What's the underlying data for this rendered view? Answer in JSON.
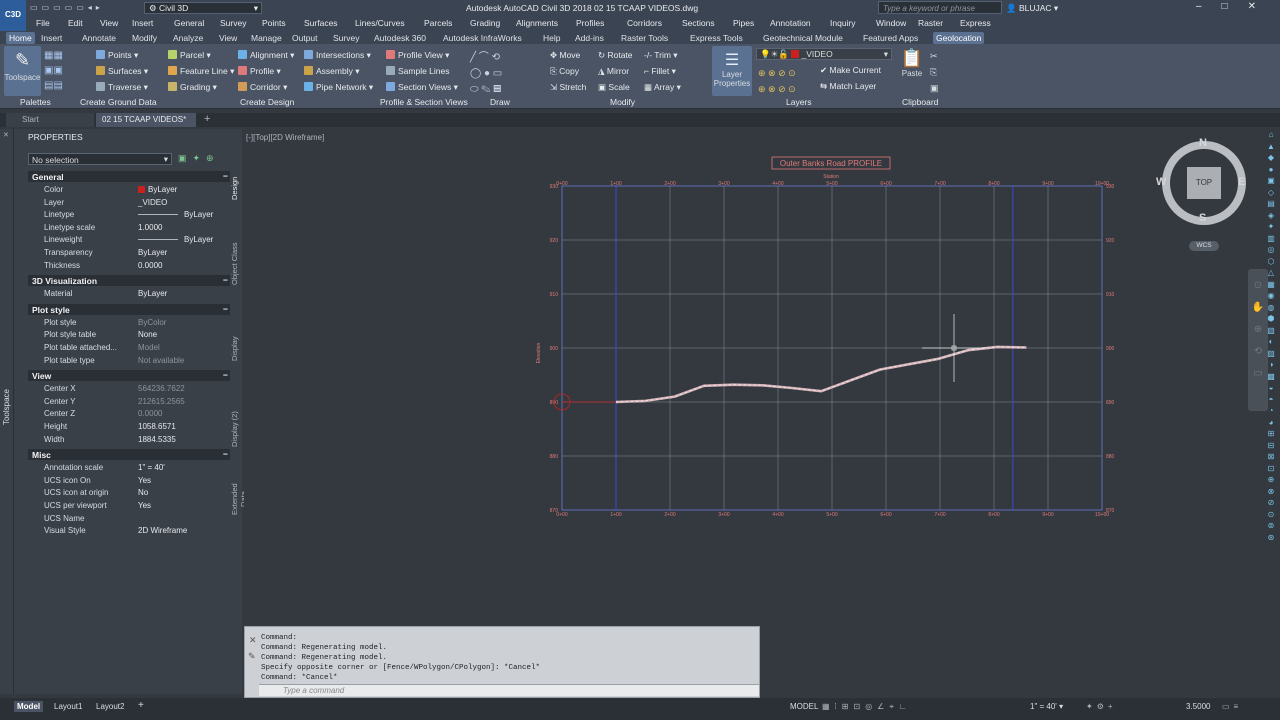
{
  "title_bar": {
    "app_name": "Civil 3D",
    "window_title": "Autodesk AutoCAD Civil 3D 2018    02 15 TCAAP VIDEOS.dwg",
    "search_placeholder": "Type a keyword or phrase",
    "user": "BLUJAC",
    "logo_letter": "C3D"
  },
  "menu": [
    "File",
    "Edit",
    "View",
    "Insert",
    "General",
    "Survey",
    "Points",
    "Surfaces",
    "Lines/Curves",
    "Parcels",
    "Grading",
    "Alignments",
    "Profiles",
    "Corridors",
    "Sections",
    "Pipes",
    "Annotation",
    "Inquiry",
    "Window",
    "Raster",
    "Express"
  ],
  "ribbon_tabs": [
    "Home",
    "Insert",
    "Annotate",
    "Modify",
    "Analyze",
    "View",
    "Manage",
    "Output",
    "Survey",
    "Autodesk 360",
    "Autodesk InfraWorks",
    "Help",
    "Add-ins",
    "Raster Tools",
    "Express Tools",
    "Geotechnical Module",
    "Featured Apps",
    "Geolocation"
  ],
  "ribbon": {
    "toolspace": "Toolspace",
    "points": "Points",
    "surfaces": "Surfaces",
    "traverse": "Traverse",
    "parcel": "Parcel",
    "feature_line": "Feature Line",
    "grading": "Grading",
    "alignment": "Alignment",
    "profile": "Profile",
    "corridor": "Corridor",
    "intersections": "Intersections",
    "assembly": "Assembly",
    "pipe_network": "Pipe Network",
    "profile_view": "Profile View",
    "sample_lines": "Sample Lines",
    "section_views": "Section Views",
    "move": "Move",
    "copy": "Copy",
    "stretch": "Stretch",
    "rotate": "Rotate",
    "mirror": "Mirror",
    "scale": "Scale",
    "trim": "Trim",
    "fillet": "Fillet",
    "array": "Array",
    "layer_properties_1": "Layer",
    "layer_properties_2": "Properties",
    "layer_name": "_VIDEO",
    "make_current": "Make Current",
    "match_layer": "Match Layer",
    "paste": "Paste",
    "panels": [
      "Palettes",
      "Create Ground Data",
      "Create Design",
      "Profile & Section Views",
      "Draw",
      "Modify",
      "Layers",
      "Clipboard"
    ]
  },
  "file_tabs": [
    "Start",
    "02 15 TCAAP VIDEOS*"
  ],
  "properties": {
    "header": "PROPERTIES",
    "selection": "No selection",
    "sections": {
      "general": "General",
      "viz": "3D Visualization",
      "plot": "Plot style",
      "view": "View",
      "misc": "Misc"
    },
    "general": [
      {
        "label": "Color",
        "value": "ByLayer",
        "swatch": "#cc1f1f"
      },
      {
        "label": "Layer",
        "value": "_VIDEO"
      },
      {
        "label": "Linetype",
        "value": "ByLayer",
        "line": true
      },
      {
        "label": "Linetype scale",
        "value": "1.0000"
      },
      {
        "label": "Lineweight",
        "value": "ByLayer",
        "line": true
      },
      {
        "label": "Transparency",
        "value": "ByLayer"
      },
      {
        "label": "Thickness",
        "value": "0.0000"
      }
    ],
    "viz": [
      {
        "label": "Material",
        "value": "ByLayer"
      }
    ],
    "plot": [
      {
        "label": "Plot style",
        "value": "ByColor",
        "dim": true
      },
      {
        "label": "Plot style table",
        "value": "None"
      },
      {
        "label": "Plot table attached...",
        "value": "Model",
        "dim": true
      },
      {
        "label": "Plot table type",
        "value": "Not available",
        "dim": true
      }
    ],
    "view": [
      {
        "label": "Center X",
        "value": "564236.7622",
        "dim": true
      },
      {
        "label": "Center Y",
        "value": "212615.2565",
        "dim": true
      },
      {
        "label": "Center Z",
        "value": "0.0000",
        "dim": true
      },
      {
        "label": "Height",
        "value": "1058.6571"
      },
      {
        "label": "Width",
        "value": "1884.5335"
      }
    ],
    "misc": [
      {
        "label": "Annotation scale",
        "value": "1\" = 40'"
      },
      {
        "label": "UCS icon On",
        "value": "Yes"
      },
      {
        "label": "UCS icon at origin",
        "value": "No"
      },
      {
        "label": "UCS per viewport",
        "value": "Yes"
      },
      {
        "label": "UCS Name",
        "value": ""
      },
      {
        "label": "Visual Style",
        "value": "2D Wireframe"
      }
    ],
    "vtabs": [
      "Design",
      "Object Class",
      "Display",
      "Display (2)",
      "Extended Data"
    ],
    "toolspace_tab": "Toolspace"
  },
  "viewport": {
    "label": "[-][Top][2D Wireframe]",
    "profile_title": "Outer Banks Road PROFILE",
    "station_label": "Station",
    "elev_label": "Elevation",
    "stations": [
      "0+00",
      "1+00",
      "2+00",
      "3+00",
      "4+00",
      "5+00",
      "6+00",
      "7+00",
      "8+00",
      "9+00",
      "10+00"
    ],
    "elevations_left": [
      "930",
      "920",
      "910",
      "900",
      "890",
      "880",
      "870"
    ],
    "elevations_right": [
      "930",
      "920",
      "910",
      "900",
      "890",
      "880",
      "870"
    ],
    "profile_elevations": [
      890.0,
      890.2,
      891.0,
      893.0,
      893.2,
      893.1,
      892.6,
      892.0,
      894.0,
      896.0,
      897.0,
      898.0,
      899.6,
      900.2,
      900.1
    ]
  },
  "viewcube": {
    "n": "N",
    "s": "S",
    "e": "E",
    "w": "W",
    "face": "TOP",
    "ucs": "WCS"
  },
  "command": {
    "history": [
      "Command:",
      "Command: Regenerating model.",
      "Command: Regenerating model.",
      "Specify opposite corner or [Fence/WPolygon/CPolygon]: *Cancel*",
      "Command: *Cancel*"
    ],
    "placeholder": "Type a command"
  },
  "status": {
    "layout_tabs": [
      "Model",
      "Layout1",
      "Layout2"
    ],
    "model": "MODEL",
    "scale": "1\" = 40'",
    "zoom": "3.5000"
  },
  "colors": {
    "grid": "#8a9098",
    "axis_blue": "#3a4ad8",
    "profile_red": "#e07a7a",
    "ground": "#d7b7bb"
  }
}
